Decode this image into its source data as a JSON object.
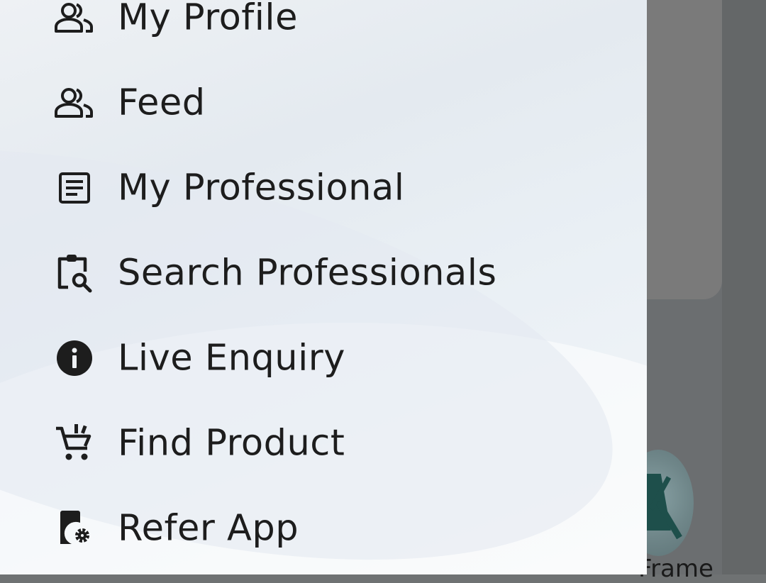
{
  "drawer": {
    "items": [
      {
        "label": "My Profile",
        "icon": "people-outline-icon"
      },
      {
        "label": "Feed",
        "icon": "people-outline-icon"
      },
      {
        "label": "My Professional",
        "icon": "article-icon"
      },
      {
        "label": "Search Professionals",
        "icon": "clipboard-search-icon"
      },
      {
        "label": "Live Enquiry",
        "icon": "info-icon"
      },
      {
        "label": "Find Product",
        "icon": "add-shopping-cart-icon"
      },
      {
        "label": "Refer App",
        "icon": "device-settings-icon"
      }
    ]
  },
  "background": {
    "partial_label": "Frame"
  },
  "colors": {
    "drawer_bg": "#e9eef3",
    "text": "#1d1d1d",
    "scrim": "#6b6e70"
  }
}
